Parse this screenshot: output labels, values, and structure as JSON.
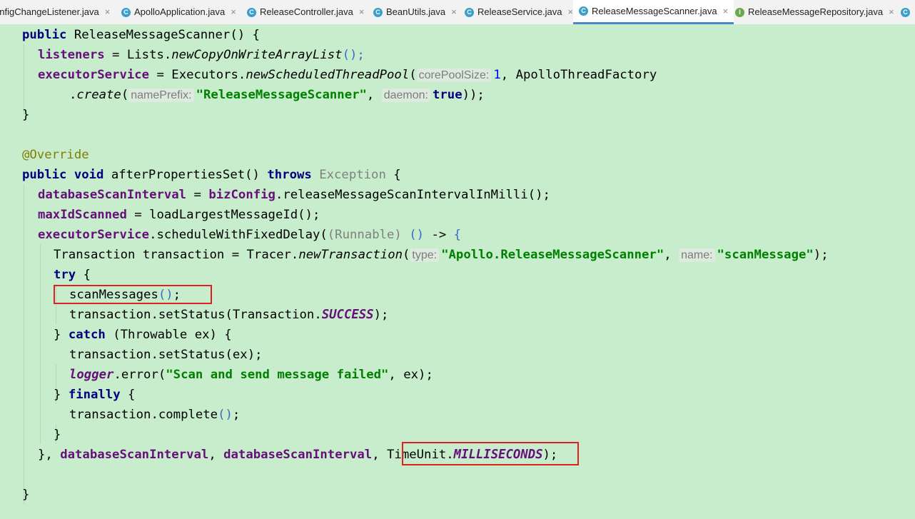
{
  "tabs": [
    {
      "label": "onfigChangeListener.java",
      "icon": "class-icon"
    },
    {
      "label": "ApolloApplication.java",
      "icon": "spring-class-icon"
    },
    {
      "label": "ReleaseController.java",
      "icon": "class-icon"
    },
    {
      "label": "BeanUtils.java",
      "icon": "class-icon"
    },
    {
      "label": "ReleaseService.java",
      "icon": "class-icon"
    },
    {
      "label": "ReleaseMessageScanner.java",
      "icon": "class-icon",
      "active": true
    },
    {
      "label": "ReleaseMessageRepository.java",
      "icon": "interface-icon"
    }
  ],
  "tab_close_glyph": "×",
  "code": {
    "l1": [
      "public",
      " ReleaseMessageScanner",
      "() {"
    ],
    "l2": [
      "listeners",
      " = Lists.",
      "newCopyOnWriteArrayList",
      "();"
    ],
    "l3": [
      "executorService",
      " = Executors.",
      "newScheduledThreadPool",
      "(",
      "corePoolSize:",
      "1",
      ", ApolloThreadFactory"
    ],
    "l4": [
      ".",
      "create",
      "(",
      "namePrefix:",
      "\"ReleaseMessageScanner\"",
      ", ",
      "daemon:",
      "true",
      "));"
    ],
    "l5": [
      "}"
    ],
    "l7": [
      "@Override"
    ],
    "l8": [
      "public",
      "void",
      " afterPropertiesSet() ",
      "throws",
      "Exception",
      " {"
    ],
    "l9": [
      "databaseScanInterval",
      " = ",
      "bizConfig",
      ".releaseMessageScanIntervalInMilli",
      "();"
    ],
    "l10": [
      "maxIdScanned",
      " = loadLargestMessageId();"
    ],
    "l11": [
      "executorService",
      ".scheduleWithFixedDelay(",
      "(Runnable)",
      "()",
      " -> ",
      "{"
    ],
    "l12": [
      "Transaction transaction = Tracer.",
      "newTransaction",
      "(",
      "type:",
      "\"Apollo.ReleaseMessageScanner\"",
      ", ",
      "name:",
      "\"scanMessage\"",
      ");"
    ],
    "l13": [
      "try",
      " {"
    ],
    "l14": [
      "scanMessages",
      "()",
      ";"
    ],
    "l15": [
      "transaction.setStatus(Transaction.",
      "SUCCESS",
      ");"
    ],
    "l16": [
      "} ",
      "catch",
      " (Throwable ex) {"
    ],
    "l17": [
      "transaction.setStatus(ex);"
    ],
    "l18": [
      "logger",
      ".error(",
      "\"Scan and send message failed\"",
      ", ex);"
    ],
    "l19": [
      "} ",
      "finally",
      " {"
    ],
    "l20": [
      "transaction.complete",
      "()",
      ";"
    ],
    "l21": [
      "}"
    ],
    "l22": [
      "}, ",
      "databaseScanInterval",
      ", ",
      "databaseScanInterval",
      ", ",
      "TimeUnit.",
      "MILLISECONDS",
      ");"
    ],
    "l24": [
      "}"
    ]
  },
  "highlights": [
    "scanMessages();",
    "TimeUnit.MILLISECONDS"
  ],
  "colors": {
    "editor_bg": "#c7edcc",
    "keyword": "#000080",
    "field": "#660e7a",
    "string": "#008000",
    "number": "#0000ff",
    "annotation": "#808000",
    "highlight_box": "#e02020",
    "active_tab_underline": "#4a88c7"
  }
}
